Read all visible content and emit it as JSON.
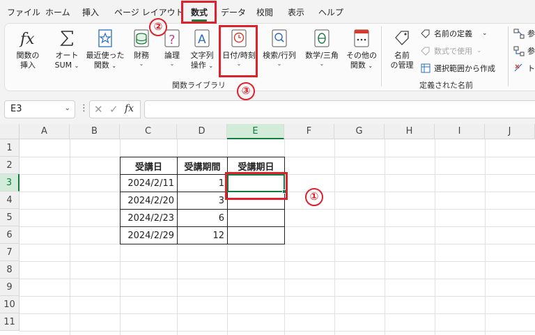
{
  "tabs": [
    {
      "label": "ファイル"
    },
    {
      "label": "ホーム"
    },
    {
      "label": "挿入"
    },
    {
      "label": "ページ レイアウト"
    },
    {
      "label": "数式"
    },
    {
      "label": "データ"
    },
    {
      "label": "校閲"
    },
    {
      "label": "表示"
    },
    {
      "label": "ヘルプ"
    }
  ],
  "active_tab": "数式",
  "ribbon": {
    "function_library": {
      "group_label": "関数ライブラリ",
      "buttons": [
        {
          "icon": "fx-icon",
          "line1": "関数の",
          "line2": "挿入"
        },
        {
          "icon": "sigma-icon",
          "line1": "オート",
          "line2": "SUM"
        },
        {
          "icon": "star-icon",
          "line1": "最近使った",
          "line2": "関数"
        },
        {
          "icon": "coins-icon",
          "line1": "財務",
          "line2": ""
        },
        {
          "icon": "question-book-icon",
          "line1": "論理",
          "line2": ""
        },
        {
          "icon": "text-a-icon",
          "line1": "文字列",
          "line2": "操作"
        },
        {
          "icon": "clock-icon",
          "line1": "日付/時刻",
          "line2": ""
        },
        {
          "icon": "magnifier-icon",
          "line1": "検索/行列",
          "line2": ""
        },
        {
          "icon": "theta-icon",
          "line1": "数学/三角",
          "line2": ""
        },
        {
          "icon": "more-functions-icon",
          "line1": "その他の",
          "line2": "関数"
        }
      ]
    },
    "defined_names": {
      "group_label": "定義された名前",
      "name_manager_line1": "名前",
      "name_manager_line2": "の管理",
      "define_name": "名前の定義",
      "use_in_formula": "数式で使用",
      "create_from_selection": "選択範囲から作成"
    },
    "formula_auditing": {
      "trace_precedents": "参",
      "trace_dependents": "参",
      "remove_arrows": "ト"
    }
  },
  "formula_bar": {
    "name_box": "E3",
    "formula": "",
    "fx_label": "fx"
  },
  "grid": {
    "columns": [
      "A",
      "B",
      "C",
      "D",
      "E",
      "F",
      "G",
      "H",
      "I",
      "J"
    ],
    "rows": [
      "1",
      "2",
      "3",
      "4",
      "5",
      "6",
      "7",
      "8",
      "9",
      "10",
      "11"
    ],
    "selected_cell": "E3",
    "table": {
      "headers": [
        "受講日",
        "受講期間",
        "受講期日"
      ],
      "rows": [
        [
          "2024/2/11",
          "1",
          ""
        ],
        [
          "2024/2/20",
          "3",
          ""
        ],
        [
          "2024/2/23",
          "6",
          ""
        ],
        [
          "2024/2/29",
          "12",
          ""
        ]
      ]
    }
  },
  "annotations": {
    "step1": "①",
    "step2": "②",
    "step3": "③",
    "color": "#e0202a"
  },
  "colors": {
    "accent_green": "#107c41",
    "annotation_red": "#e0202a"
  }
}
